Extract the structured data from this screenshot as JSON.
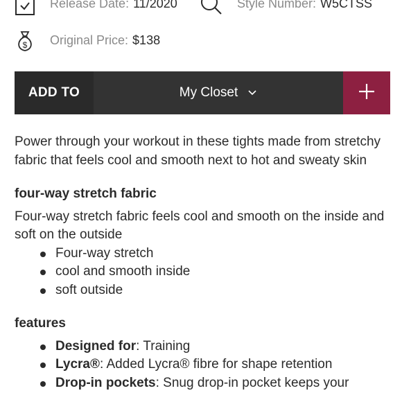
{
  "meta": {
    "release_label": "Release Date:",
    "release_value": "11/2020",
    "style_label": "Style Number:",
    "style_value": "W5CTSS",
    "price_label": "Original Price:",
    "price_value": "$138"
  },
  "add_bar": {
    "add_to_label": "ADD TO",
    "closet_label": "My Closet",
    "plus_label": "+"
  },
  "description": "Power through your workout in these tights made from stretchy fabric that feels cool and smooth next to hot and sweaty skin",
  "stretch_section": {
    "heading": "four-way stretch fabric",
    "text": "Four-way stretch fabric feels cool and smooth on the inside and soft on the outside",
    "bullets": [
      "Four-way stretch",
      "cool and smooth inside",
      "soft outside"
    ]
  },
  "features_section": {
    "heading": "features",
    "items": [
      {
        "term": "Designed for",
        "text": ": Training"
      },
      {
        "term": "Lycra®",
        "text": ": Added Lycra® fibre for shape retention"
      },
      {
        "term": "Drop-in pockets",
        "text": ": Snug drop-in pocket keeps your"
      }
    ]
  },
  "icons": {
    "calendar": "calendar-check-icon",
    "search": "search-icon",
    "money": "money-bag-icon",
    "chevron": "chevron-down-icon",
    "plus": "plus-icon"
  }
}
